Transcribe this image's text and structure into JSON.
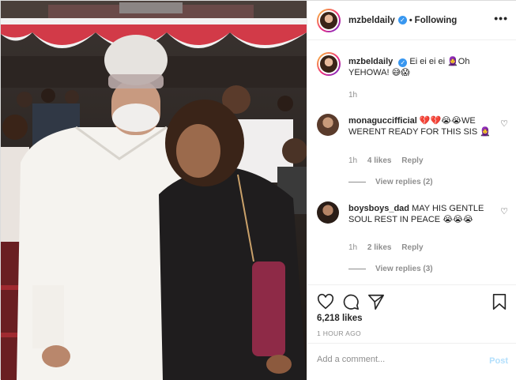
{
  "header": {
    "username": "mzbeldaily",
    "verified_mark": "✓",
    "separator": "•",
    "follow_label": "Following",
    "more_label": "•••"
  },
  "caption": {
    "username": "mzbeldaily",
    "text": "Ei ei ei ei 🧕Oh YEHOWA! 😅😱",
    "time": "1h"
  },
  "comments": [
    {
      "username": "monaguccifficial",
      "text": "💔💔😭😭WE WERENT READY FOR THIS SIS 🧕",
      "time": "1h",
      "likes": "4 likes",
      "reply_label": "Reply",
      "view_replies": "View replies (2)"
    },
    {
      "username": "boysboys_dad",
      "text": "MAY HIS GENTLE SOUL REST IN PEACE 😭😭😭",
      "time": "1h",
      "likes": "2 likes",
      "reply_label": "Reply",
      "view_replies": "View replies (3)"
    }
  ],
  "icons": {
    "like": "heart-icon",
    "comment": "comment-icon",
    "share": "share-icon",
    "save": "bookmark-icon",
    "comment_like": "heart-small-icon"
  },
  "stats": {
    "likes": "6,218 likes",
    "posted": "1 HOUR AGO"
  },
  "add_comment": {
    "placeholder": "Add a comment...",
    "post_label": "Post"
  },
  "colors": {
    "link_blue": "#3897f0",
    "post_disabled": "#b2dffc",
    "muted": "#8e8e8e"
  }
}
